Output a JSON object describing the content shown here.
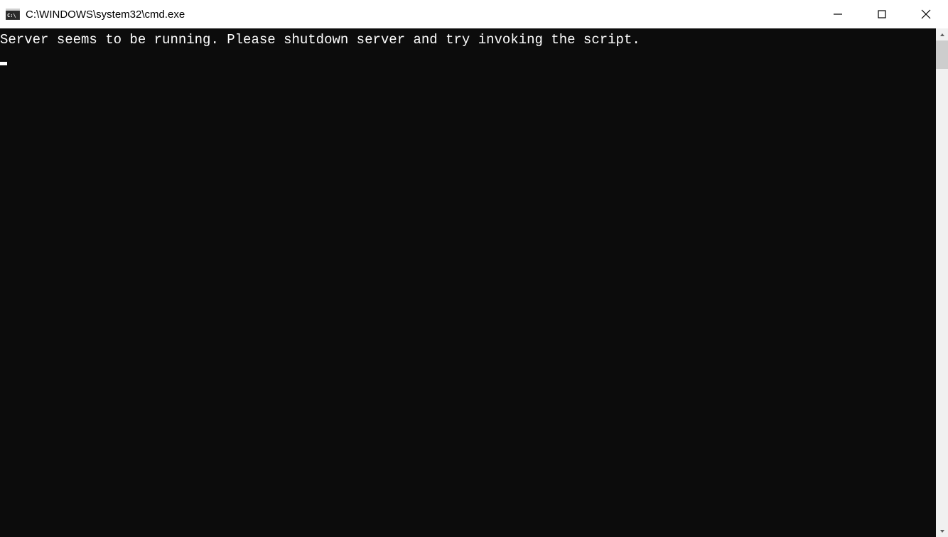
{
  "titlebar": {
    "title": "C:\\WINDOWS\\system32\\cmd.exe"
  },
  "terminal": {
    "lines": [
      "Server seems to be running. Please shutdown server and try invoking the script."
    ]
  }
}
